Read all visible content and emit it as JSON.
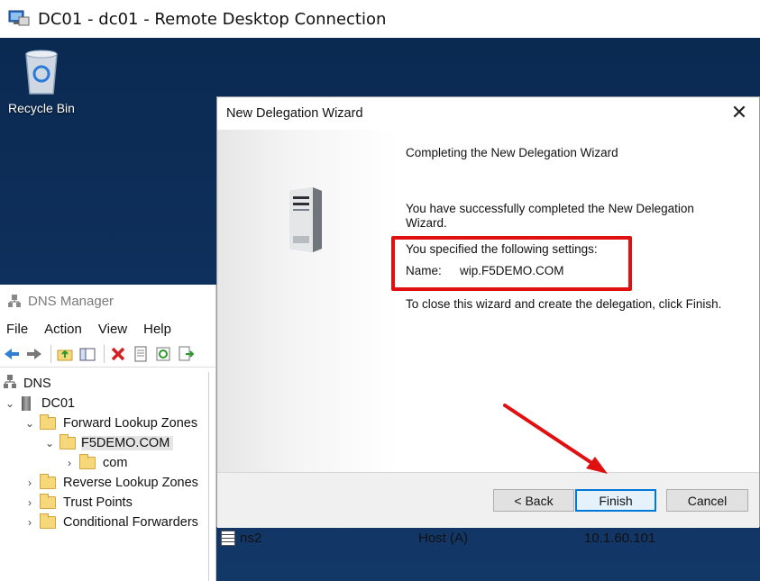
{
  "rdp": {
    "title": "DC01 - dc01 - Remote Desktop Connection"
  },
  "desktop": {
    "recycle_bin_label": "Recycle Bin"
  },
  "dns_manager": {
    "title": "DNS Manager",
    "menu": [
      "File",
      "Action",
      "View",
      "Help"
    ],
    "tree": [
      {
        "label": "DNS",
        "expanded": true
      },
      {
        "label": "DC01",
        "expanded": true
      },
      {
        "label": "Forward Lookup Zones",
        "expanded": true
      },
      {
        "label": "F5DEMO.COM",
        "expanded": true,
        "selected": true
      },
      {
        "label": "com",
        "expanded": false
      },
      {
        "label": "Reverse Lookup Zones",
        "expanded": false
      },
      {
        "label": "Trust Points",
        "expanded": false
      },
      {
        "label": "Conditional Forwarders",
        "expanded": false
      }
    ],
    "list_row": {
      "name": "ns2",
      "type": "Host (A)",
      "data": "10.1.60.101"
    }
  },
  "wizard": {
    "title": "New Delegation Wizard",
    "heading": "Completing the New Delegation Wizard",
    "success_text": "You have successfully completed the New Delegation Wizard.",
    "settings_label": "You specified the following settings:",
    "name_label": "Name:",
    "name_value": "wip.F5DEMO.COM",
    "close_text": "To close this wizard and create the delegation, click Finish.",
    "buttons": {
      "back": "< Back",
      "finish": "Finish",
      "cancel": "Cancel"
    }
  },
  "annotations": {
    "highlight_color": "#e01010",
    "arrow_color": "#e01010"
  },
  "colors": {
    "desktop_bg": "#0f315e",
    "finish_border": "#0078d7"
  }
}
